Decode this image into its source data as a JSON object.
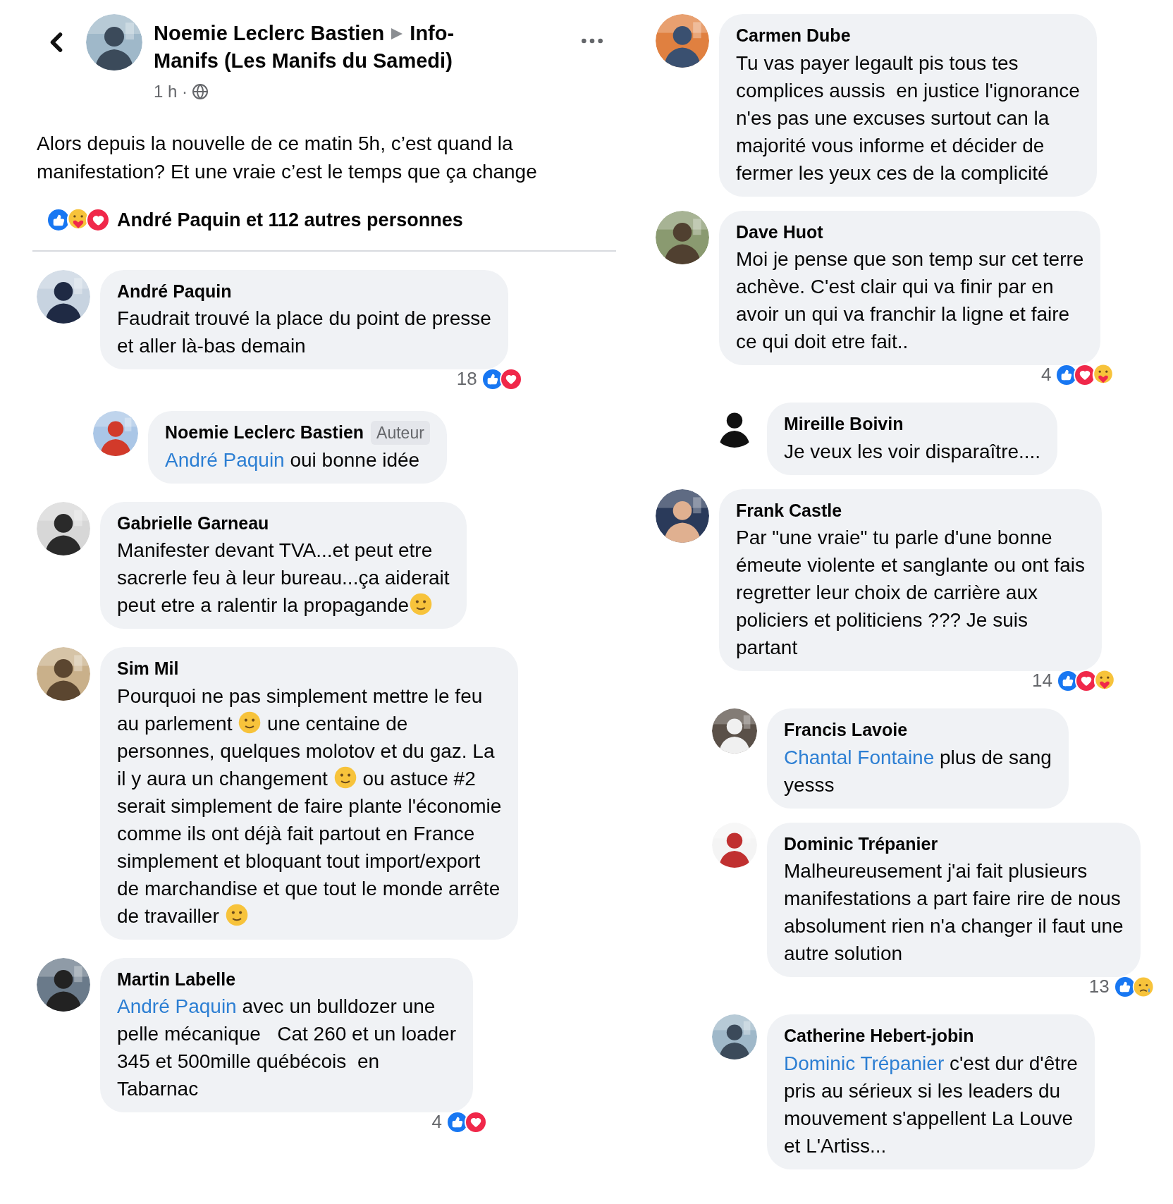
{
  "post": {
    "author": "Noemie Leclerc Bastien",
    "group": "Info-Manifs (Les Manifs du Samedi)",
    "time": "1 h ·",
    "lines": [
      "Alors depuis la nouvelle de ce matin 5h, c’est quand la",
      "manifestation? Et une vraie c’est le temps que ça change"
    ],
    "reactions": {
      "icons": [
        {
          "kind": "like"
        },
        {
          "kind": "care"
        },
        {
          "kind": "love"
        }
      ],
      "text": "André Paquin et 112 autres personnes"
    }
  },
  "left_comments": [
    {
      "author": "André Paquin",
      "reply": false,
      "lines": [
        [
          "Faudrait trouvé la place du point de presse"
        ],
        [
          "et aller là-bas demain"
        ]
      ],
      "reactions": {
        "count": "18",
        "icons": [
          {
            "kind": "like"
          },
          {
            "kind": "love"
          }
        ]
      }
    },
    {
      "author": "Noemie Leclerc Bastien",
      "badge": "Auteur",
      "reply": true,
      "mention": "André Paquin",
      "lines": [
        [
          " oui bonne idée"
        ]
      ]
    },
    {
      "author": "Gabrielle Garneau",
      "reply": false,
      "lines": [
        [
          "Manifester devant TVA...et peut etre"
        ],
        [
          "sacrerle feu à leur bureau...ça aiderait"
        ],
        [
          "peut etre a ralentir la propagande",
          {
            "kind": "emoji"
          }
        ]
      ]
    },
    {
      "author": "Sim Mil",
      "reply": false,
      "lines": [
        [
          "Pourquoi ne pas simplement mettre le feu"
        ],
        [
          "au parlement ",
          {
            "kind": "emoji"
          },
          " une centaine de"
        ],
        [
          "personnes, quelques molotov et du gaz. La"
        ],
        [
          "il y aura un changement ",
          {
            "kind": "emoji"
          },
          " ou astuce #2"
        ],
        [
          "serait simplement de faire plante l'économie"
        ],
        [
          "comme ils ont déjà fait partout en France"
        ],
        [
          "simplement et bloquant tout import/export"
        ],
        [
          "de marchandise et que tout le monde arrête"
        ],
        [
          "de travailler ",
          {
            "kind": "emoji"
          }
        ]
      ]
    },
    {
      "author": "Martin Labelle",
      "reply": false,
      "mention": "André Paquin",
      "lines": [
        [
          " avec un bulldozer une"
        ],
        [
          "pelle mécanique   Cat 260 et un loader"
        ],
        [
          "345 et 500mille québécois  en"
        ],
        [
          "Tabarnac"
        ]
      ],
      "reactions": {
        "count": "4",
        "icons": [
          {
            "kind": "like"
          },
          {
            "kind": "love"
          }
        ]
      }
    }
  ],
  "right_comments": [
    {
      "author": "Carmen Dube",
      "reply": false,
      "lines": [
        [
          "Tu vas payer legault pis tous tes"
        ],
        [
          "complices aussis  en justice l'ignorance"
        ],
        [
          "n'es pas une excuses surtout can la"
        ],
        [
          "majorité vous informe et décider de"
        ],
        [
          "fermer les yeux ces de la complicité"
        ]
      ]
    },
    {
      "author": "Dave Huot",
      "reply": false,
      "lines": [
        [
          "Moi je pense que son temp sur cet terre"
        ],
        [
          "achève. C'est clair qui va finir par en"
        ],
        [
          "avoir un qui va franchir la ligne et faire"
        ],
        [
          "ce qui doit etre fait.."
        ]
      ],
      "reactions": {
        "count": "4",
        "icons": [
          {
            "kind": "like"
          },
          {
            "kind": "love"
          },
          {
            "kind": "care"
          }
        ]
      }
    },
    {
      "author": "Mireille Boivin",
      "reply": true,
      "lines": [
        [
          "Je veux les voir disparaître...."
        ]
      ]
    },
    {
      "author": "Frank Castle",
      "reply": false,
      "lines": [
        [
          "Par \"une vraie\" tu parle d'une bonne"
        ],
        [
          "émeute violente et sanglante ou ont fais"
        ],
        [
          "regretter leur choix de carrière aux"
        ],
        [
          "policiers et politiciens ??? Je suis"
        ],
        [
          "partant"
        ]
      ],
      "reactions": {
        "count": "14",
        "icons": [
          {
            "kind": "like"
          },
          {
            "kind": "love"
          },
          {
            "kind": "care"
          }
        ]
      }
    },
    {
      "author": "Francis Lavoie",
      "reply": true,
      "mention": "Chantal Fontaine",
      "lines": [
        [
          " plus de sang"
        ],
        [
          "yesss"
        ]
      ]
    },
    {
      "author": "Dominic Trépanier",
      "reply": true,
      "lines": [
        [
          "Malheureusement j'ai fait plusieurs"
        ],
        [
          "manifestations a part faire rire de nous"
        ],
        [
          "absolument rien n'a changer il faut une"
        ],
        [
          "autre solution"
        ]
      ],
      "reactions": {
        "count": "13",
        "icons": [
          {
            "kind": "like"
          },
          {
            "kind": "sad"
          }
        ]
      }
    },
    {
      "author": "Catherine Hebert-jobin",
      "reply": true,
      "mention": "Dominic Trépanier",
      "lines": [
        [
          " c'est dur d'être"
        ],
        [
          "pris au sérieux si les leaders du"
        ],
        [
          "mouvement s'appellent La Louve"
        ],
        [
          "et L'Artiss..."
        ]
      ]
    }
  ]
}
